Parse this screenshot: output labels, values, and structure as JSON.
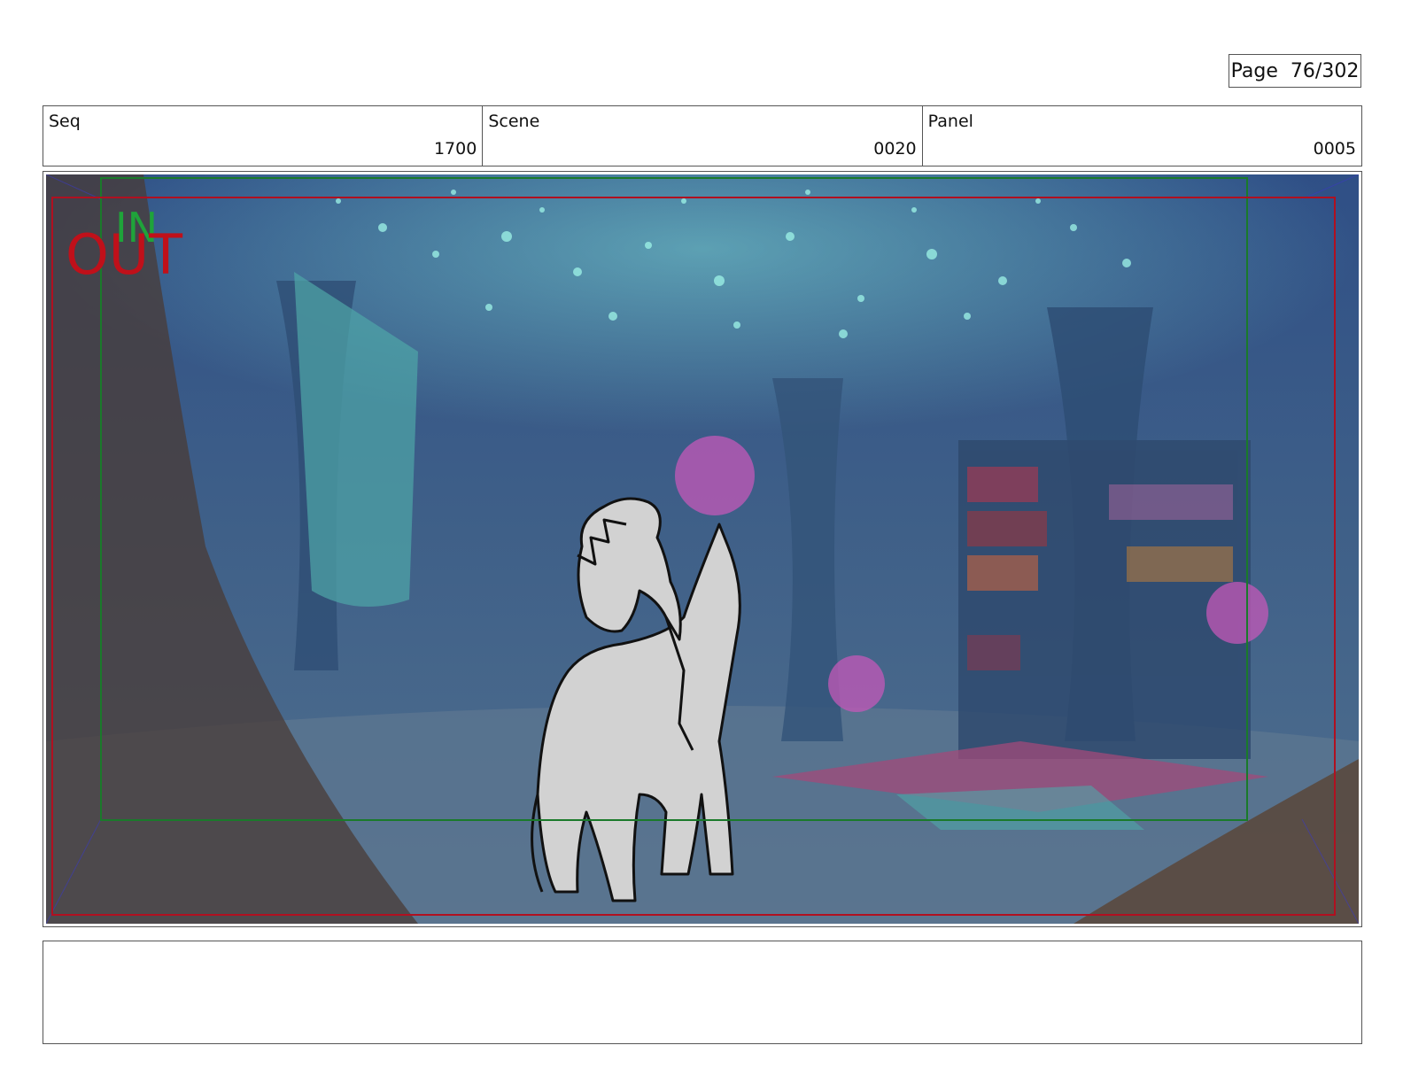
{
  "page": {
    "label": "Page",
    "number": "76/302"
  },
  "header": {
    "seq": {
      "label": "Seq",
      "value": "1700"
    },
    "scene": {
      "label": "Scene",
      "value": "0020"
    },
    "panel": {
      "label": "Panel",
      "value": "0005"
    }
  },
  "frame": {
    "in_marker": "IN",
    "out_marker": "OUT",
    "colors": {
      "in": "#1fa33a",
      "out": "#c0101a",
      "safe_green": "#1a7a2a",
      "border_red": "#b01020"
    }
  },
  "notes": {
    "text": ""
  }
}
